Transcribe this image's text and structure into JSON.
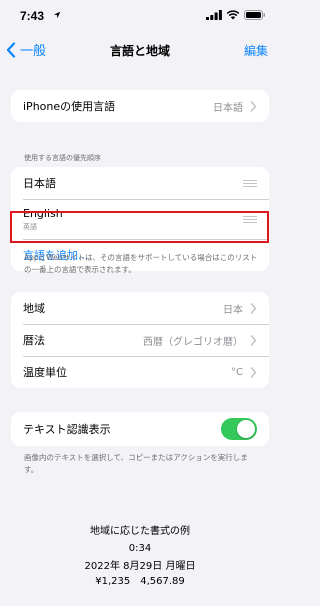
{
  "status": {
    "time": "7:43"
  },
  "nav": {
    "back_label": "一般",
    "title": "言語と地域",
    "action_label": "編集"
  },
  "iphone_language": {
    "label": "iPhoneの使用言語",
    "value": "日本語"
  },
  "preferred": {
    "header": "使用する言語の優先順序",
    "languages": [
      {
        "name": "日本語",
        "sub": ""
      },
      {
        "name": "English",
        "sub": "英語"
      }
    ],
    "add_label": "言語を追加...",
    "footer": "AppとWebサイトは、その言語をサポートしている場合はこのリストの一番上の言語で表示されます。"
  },
  "region_group": {
    "rows": [
      {
        "label": "地域",
        "value": "日本"
      },
      {
        "label": "暦法",
        "value": "西暦（グレゴリオ暦）"
      },
      {
        "label": "温度単位",
        "value": "°C"
      }
    ]
  },
  "live_text": {
    "label": "テキスト認識表示",
    "enabled": true,
    "footer": "画像内のテキストを選択して、コピーまたはアクションを実行します。"
  },
  "format_example": {
    "title": "地域に応じた書式の例",
    "time": "0:34",
    "date": "2022年 8月29日 月曜日",
    "numbers": "¥1,235　4,567.89"
  },
  "colors": {
    "accent": "#0a84ff",
    "toggle_on": "#34c759",
    "highlight": "#e0161e"
  }
}
